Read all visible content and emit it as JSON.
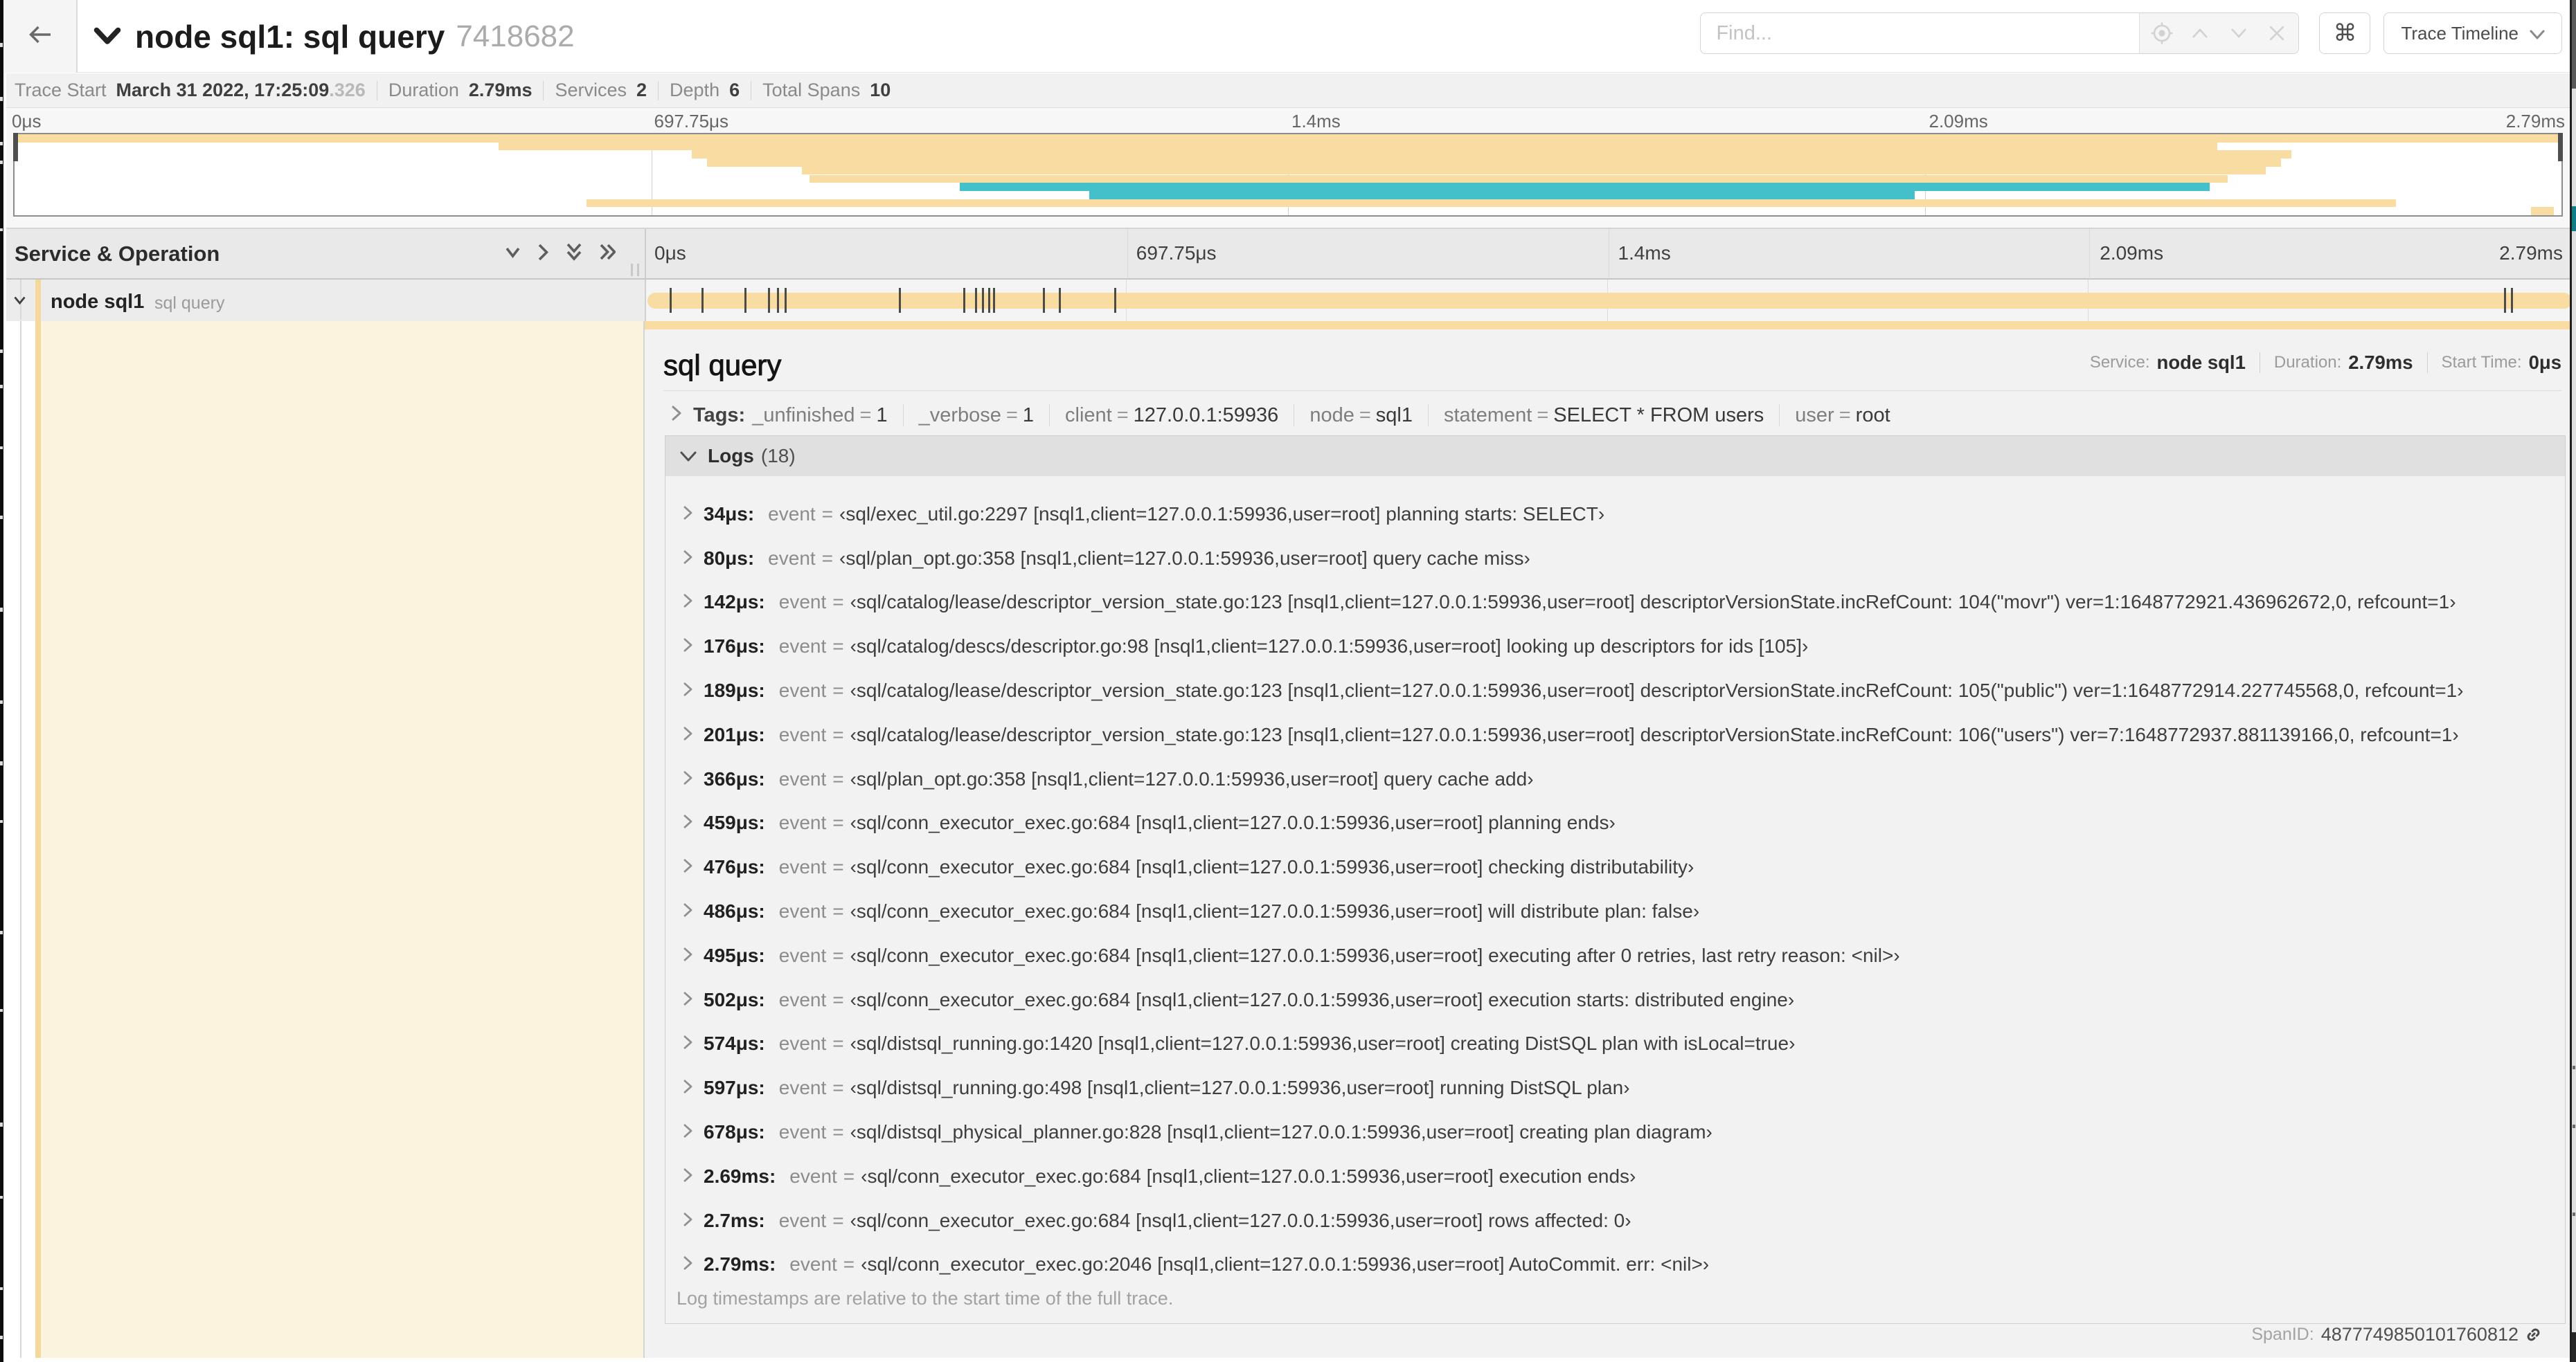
{
  "header": {
    "title": "node sql1: sql query",
    "trace_id": "7418682",
    "find_placeholder": "Find...",
    "shortcut_symbol": "⌘",
    "view_select_label": "Trace Timeline"
  },
  "summary": {
    "items": [
      {
        "label": "Trace Start",
        "value": "March 31 2022, 17:25:09",
        "suffix": ".326"
      },
      {
        "label": "Duration",
        "value": "2.79ms"
      },
      {
        "label": "Services",
        "value": "2"
      },
      {
        "label": "Depth",
        "value": "6"
      },
      {
        "label": "Total Spans",
        "value": "10"
      }
    ]
  },
  "colors": {
    "tan": "#f8dca1",
    "teal": "#44c0ca",
    "detail_accent": "#f8dca1"
  },
  "minimap": {
    "labels": [
      "0μs",
      "697.75μs",
      "1.4ms",
      "2.09ms",
      "2.79ms"
    ],
    "rows": [
      {
        "color": "tan",
        "start": 0.0,
        "end": 1.0
      },
      {
        "color": "tan",
        "start": 0.19,
        "end": 0.865
      },
      {
        "color": "tan",
        "start": 0.266,
        "end": 0.894
      },
      {
        "color": "tan",
        "start": 0.272,
        "end": 0.89
      },
      {
        "color": "tan",
        "start": 0.309,
        "end": 0.884
      },
      {
        "color": "tan",
        "start": 0.312,
        "end": 0.869
      },
      {
        "color": "teal",
        "start": 0.371,
        "end": 0.862
      },
      {
        "color": "teal",
        "start": 0.422,
        "end": 0.746
      },
      {
        "color": "tan",
        "start": 0.2245,
        "end": 0.935
      },
      {
        "color": "tan",
        "start": 0.988,
        "end": 0.997
      }
    ]
  },
  "timeline": {
    "column_header": "Service & Operation",
    "ticks": [
      "0μs",
      "697.75μs",
      "1.4ms",
      "2.09ms",
      "2.79ms"
    ],
    "span": {
      "service": "node sql1",
      "operation": "sql query",
      "duration_us": 2790,
      "log_times_us": [
        34,
        80,
        142,
        176,
        189,
        201,
        366,
        459,
        476,
        486,
        495,
        502,
        574,
        597,
        678,
        2690,
        2700,
        2790
      ]
    }
  },
  "detail": {
    "title": "sql query",
    "meta": [
      {
        "label": "Service:",
        "value": "node sql1"
      },
      {
        "label": "Duration:",
        "value": "2.79ms"
      },
      {
        "label": "Start Time:",
        "value": "0μs"
      }
    ],
    "tags_label": "Tags:",
    "tags": [
      {
        "key": "_unfinished",
        "value": "1"
      },
      {
        "key": "_verbose",
        "value": "1"
      },
      {
        "key": "client",
        "value": "127.0.0.1:59936"
      },
      {
        "key": "node",
        "value": "sql1"
      },
      {
        "key": "statement",
        "value": "SELECT * FROM users"
      },
      {
        "key": "user",
        "value": "root"
      }
    ],
    "logs_label": "Logs",
    "logs_count": "(18)",
    "log_key": "event",
    "logs": [
      {
        "ts": "34μs:",
        "value": "‹sql/exec_util.go:2297 [nsql1,client=127.0.0.1:59936,user=root] planning starts: SELECT›"
      },
      {
        "ts": "80μs:",
        "value": "‹sql/plan_opt.go:358 [nsql1,client=127.0.0.1:59936,user=root] query cache miss›"
      },
      {
        "ts": "142μs:",
        "value": "‹sql/catalog/lease/descriptor_version_state.go:123 [nsql1,client=127.0.0.1:59936,user=root] descriptorVersionState.incRefCount: 104(\"movr\") ver=1:1648772921.436962672,0, refcount=1›"
      },
      {
        "ts": "176μs:",
        "value": "‹sql/catalog/descs/descriptor.go:98 [nsql1,client=127.0.0.1:59936,user=root] looking up descriptors for ids [105]›"
      },
      {
        "ts": "189μs:",
        "value": "‹sql/catalog/lease/descriptor_version_state.go:123 [nsql1,client=127.0.0.1:59936,user=root] descriptorVersionState.incRefCount: 105(\"public\") ver=1:1648772914.227745568,0, refcount=1›"
      },
      {
        "ts": "201μs:",
        "value": "‹sql/catalog/lease/descriptor_version_state.go:123 [nsql1,client=127.0.0.1:59936,user=root] descriptorVersionState.incRefCount: 106(\"users\") ver=7:1648772937.881139166,0, refcount=1›"
      },
      {
        "ts": "366μs:",
        "value": "‹sql/plan_opt.go:358 [nsql1,client=127.0.0.1:59936,user=root] query cache add›"
      },
      {
        "ts": "459μs:",
        "value": "‹sql/conn_executor_exec.go:684 [nsql1,client=127.0.0.1:59936,user=root] planning ends›"
      },
      {
        "ts": "476μs:",
        "value": "‹sql/conn_executor_exec.go:684 [nsql1,client=127.0.0.1:59936,user=root] checking distributability›"
      },
      {
        "ts": "486μs:",
        "value": "‹sql/conn_executor_exec.go:684 [nsql1,client=127.0.0.1:59936,user=root] will distribute plan: false›"
      },
      {
        "ts": "495μs:",
        "value": "‹sql/conn_executor_exec.go:684 [nsql1,client=127.0.0.1:59936,user=root] executing after 0 retries, last retry reason: <nil>›"
      },
      {
        "ts": "502μs:",
        "value": "‹sql/conn_executor_exec.go:684 [nsql1,client=127.0.0.1:59936,user=root] execution starts: distributed engine›"
      },
      {
        "ts": "574μs:",
        "value": "‹sql/distsql_running.go:1420 [nsql1,client=127.0.0.1:59936,user=root] creating DistSQL plan with isLocal=true›"
      },
      {
        "ts": "597μs:",
        "value": "‹sql/distsql_running.go:498 [nsql1,client=127.0.0.1:59936,user=root] running DistSQL plan›"
      },
      {
        "ts": "678μs:",
        "value": "‹sql/distsql_physical_planner.go:828 [nsql1,client=127.0.0.1:59936,user=root] creating plan diagram›"
      },
      {
        "ts": "2.69ms:",
        "value": "‹sql/conn_executor_exec.go:684 [nsql1,client=127.0.0.1:59936,user=root] execution ends›"
      },
      {
        "ts": "2.7ms:",
        "value": "‹sql/conn_executor_exec.go:684 [nsql1,client=127.0.0.1:59936,user=root] rows affected: 0›"
      },
      {
        "ts": "2.79ms:",
        "value": "‹sql/conn_executor_exec.go:2046 [nsql1,client=127.0.0.1:59936,user=root] AutoCommit. err: <nil>›"
      }
    ],
    "logs_footer": "Log timestamps are relative to the start time of the full trace.",
    "span_id_label": "SpanID:",
    "span_id": "4877749850101760812"
  }
}
